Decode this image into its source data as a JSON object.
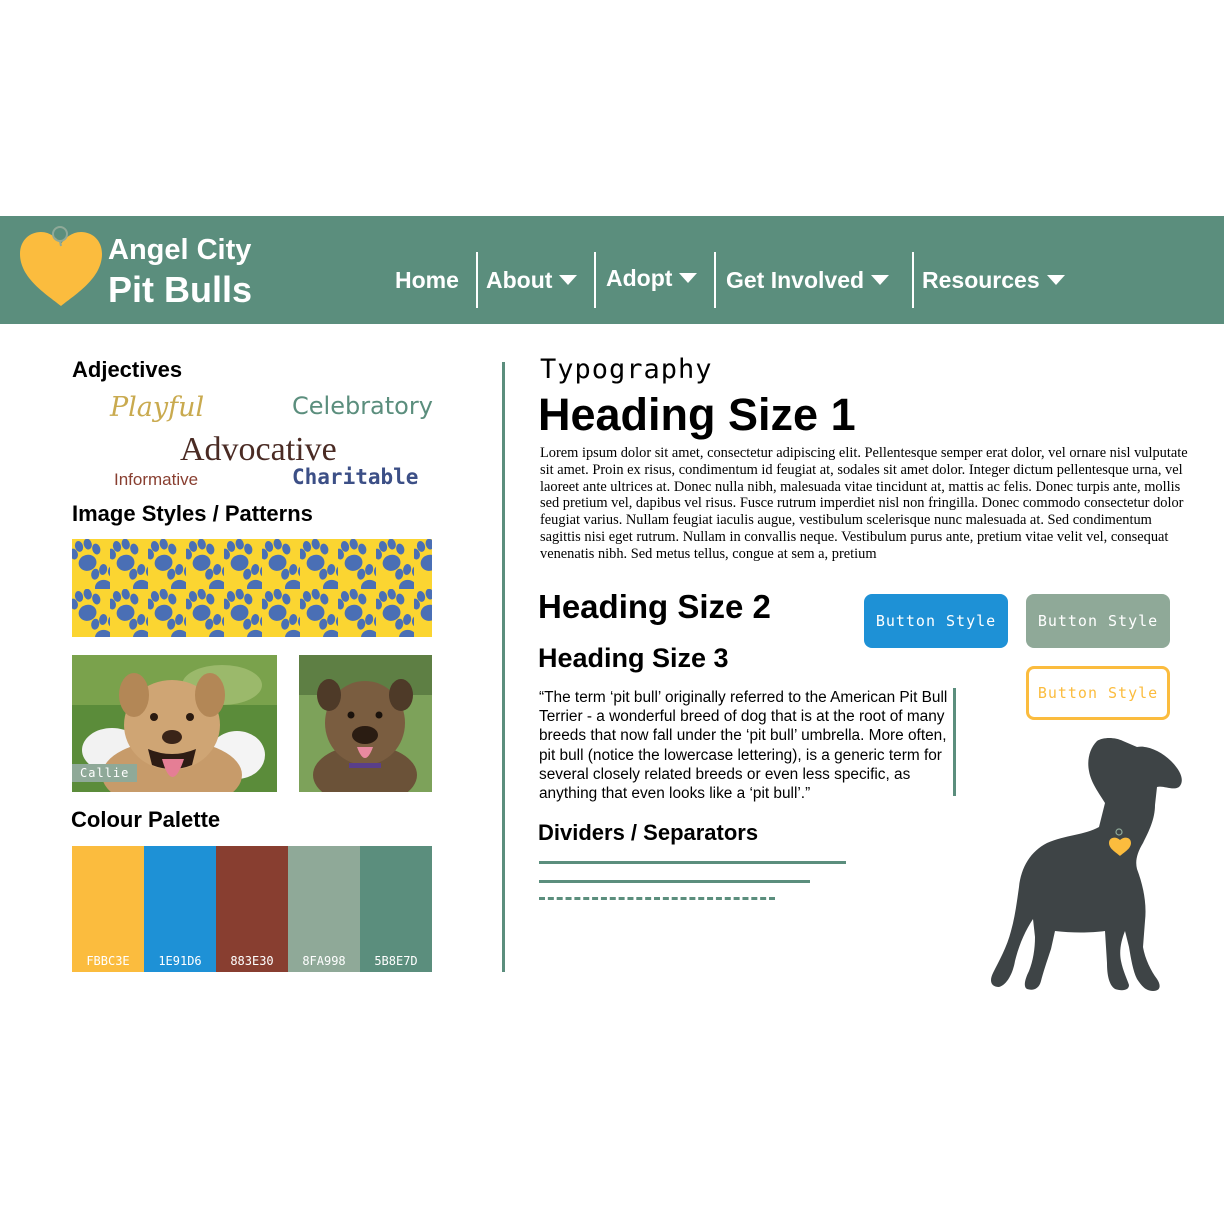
{
  "header": {
    "logo_line1": "Angel City",
    "logo_line2": "Pit Bulls",
    "nav": [
      {
        "label": "Home",
        "has_dropdown": false
      },
      {
        "label": "About",
        "has_dropdown": true
      },
      {
        "label": "Adopt",
        "has_dropdown": true
      },
      {
        "label": "Get Involved",
        "has_dropdown": true
      },
      {
        "label": "Resources",
        "has_dropdown": true
      }
    ]
  },
  "left": {
    "adjectives_title": "Adjectives",
    "adjectives": {
      "playful": "Playful",
      "celebratory": "Celebratory",
      "advocative": "Advocative",
      "informative": "Informative",
      "charitable": "Charitable"
    },
    "image_styles_title": "Image Styles / Patterns",
    "photo_caption": "Callie",
    "palette_title": "Colour Palette",
    "palette": [
      {
        "label": "FBBC3E",
        "color": "#fbbc3e"
      },
      {
        "label": "1E91D6",
        "color": "#1e91d6"
      },
      {
        "label": "883E30",
        "color": "#883e30"
      },
      {
        "label": "8FA998",
        "color": "#8fa998"
      },
      {
        "label": "5B8E7D",
        "color": "#5b8e7d"
      }
    ]
  },
  "right": {
    "typography_title": "Typography",
    "heading1": "Heading Size 1",
    "lorem": "Lorem ipsum dolor sit amet, consectetur adipiscing elit. Pellentesque semper erat dolor, vel ornare nisl vulputate sit amet. Proin ex risus, condimentum id feugiat at, sodales sit amet dolor. Integer dictum pellentesque urna, vel laoreet ante ultrices at. Donec nulla nibh, malesuada vitae tincidunt at, mattis ac felis. Donec turpis ante, mollis sed pretium vel, dapibus vel risus. Fusce rutrum imperdiet nisl non fringilla. Donec commodo consectetur dolor feugiat varius. Nullam feugiat iaculis augue, vestibulum scelerisque nunc malesuada at. Sed condimentum sagittis nisi eget rutrum. Nullam in convallis neque. Vestibulum purus ante, pretium vitae velit vel, consequat venenatis nibh. Sed metus tellus, congue at sem a, pretium",
    "heading2": "Heading Size 2",
    "heading3": "Heading Size 3",
    "quote": "“The term ‘pit bull’ originally referred to the American Pit Bull Terrier - a wonderful breed of dog that is at the root of many breeds that now fall under the ‘pit bull’ umbrella. More often, pit bull (notice the lowercase lettering), is a generic term for several closely related breeds or even less specific, as anything that even looks like a ‘pit bull’.”",
    "dividers_title": "Dividers / Separators",
    "buttons": {
      "primary": "Button Style",
      "secondary": "Button Style",
      "outline": "Button Style"
    }
  },
  "colors": {
    "brand_green": "#5b8e7d",
    "yellow": "#fbbc3e",
    "blue": "#1e91d6",
    "rust": "#883e30",
    "sage": "#8fa998",
    "pattern_blue": "#4a6fb5",
    "pattern_yellow": "#fbd531",
    "silhouette": "#3e4446"
  },
  "icons": {
    "logo": "heart-tag-icon",
    "dropdown": "caret-down-icon",
    "pattern": "paw-print-icon",
    "silhouette": "dog-silhouette-icon"
  }
}
